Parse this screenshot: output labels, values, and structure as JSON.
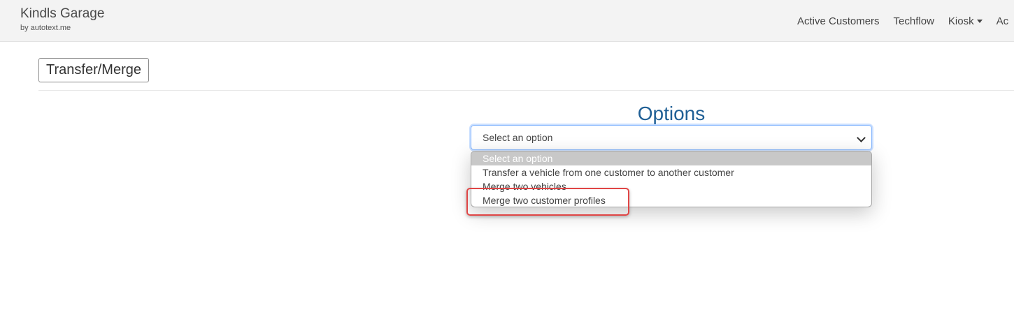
{
  "navbar": {
    "brand_title": "Kindls Garage",
    "brand_sub": "by autotext.me",
    "links": [
      {
        "label": "Active Customers"
      },
      {
        "label": "Techflow"
      },
      {
        "label": "Kiosk"
      },
      {
        "label": "Ac"
      }
    ]
  },
  "page": {
    "title": "Transfer/Merge"
  },
  "options": {
    "heading": "Options",
    "select_value": "Select an option",
    "items": [
      {
        "label": "Select an option"
      },
      {
        "label": "Transfer a vehicle from one customer to another customer"
      },
      {
        "label": "Merge two vehicles"
      },
      {
        "label": "Merge two customer profiles"
      }
    ]
  },
  "colors": {
    "heading": "#1f5f95",
    "highlight": "#e04646",
    "selected_option_bg": "#c8c8c8"
  }
}
